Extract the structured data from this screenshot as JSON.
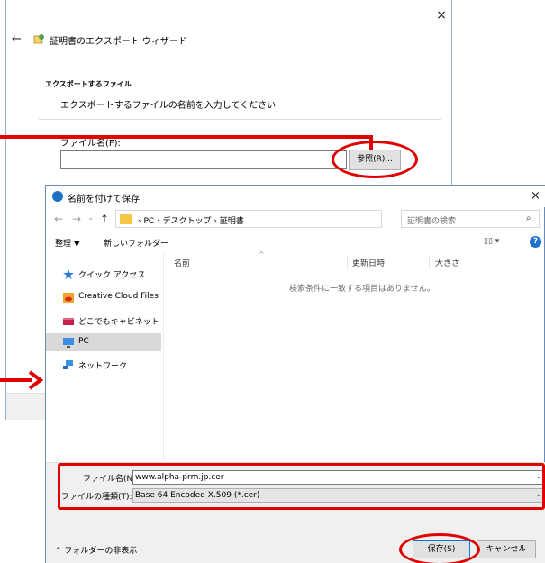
{
  "wizard": {
    "title": "証明書のエクスポート ウィザード",
    "section_title": "エクスポートするファイル",
    "description": "エクスポートするファイルの名前を入力してください",
    "file_name_label": "ファイル名(F):",
    "file_name_value": "",
    "browse_label": "参照(R)...",
    "close_icon": "×",
    "back_icon": "←"
  },
  "dialog": {
    "title": "名前を付けて保存",
    "close_icon": "×",
    "nav": {
      "back_icon": "←",
      "forward_icon": "→",
      "recent_icon": "⌄",
      "up_icon": "↑",
      "breadcrumb": "› PC › デスクトップ › 証明書",
      "dropdown_icon": "⌄",
      "refresh_icon": "↻",
      "search_placeholder": "証明書の検索",
      "search_icon": "⌕"
    },
    "toolbar": {
      "organize": "整理 ▼",
      "new_folder": "新しいフォルダー",
      "view": "▯▯ ▾",
      "help": "?"
    },
    "sidebar": {
      "items": [
        {
          "label": "クイック アクセス",
          "icon": "star-icon"
        },
        {
          "label": "Creative Cloud Files",
          "icon": "creative-cloud-icon"
        },
        {
          "label": "どこでもキャビネット",
          "icon": "cabinet-icon"
        },
        {
          "label": "PC",
          "icon": "pc-icon",
          "selected": true
        },
        {
          "label": "ネットワーク",
          "icon": "network-icon"
        }
      ]
    },
    "columns": {
      "name": "名前",
      "date": "更新日時",
      "size": "大きさ",
      "sort_indicator": "^"
    },
    "empty_message": "検索条件に一致する項目はありません。",
    "file_name_label": "ファイル名(N):",
    "file_name_value": "www.alpha-prm.jp.cer",
    "file_type_label": "ファイルの種類(T):",
    "file_type_value": "Base 64 Encoded X.509 (*.cer)",
    "dropdown_arrow": "⌄",
    "hide_folders": "^ フォルダーの非表示",
    "save_label": "保存(S)",
    "cancel_label": "キャンセル"
  },
  "colors": {
    "annotation_red": "#e00000",
    "accent_blue": "#0078d7"
  }
}
